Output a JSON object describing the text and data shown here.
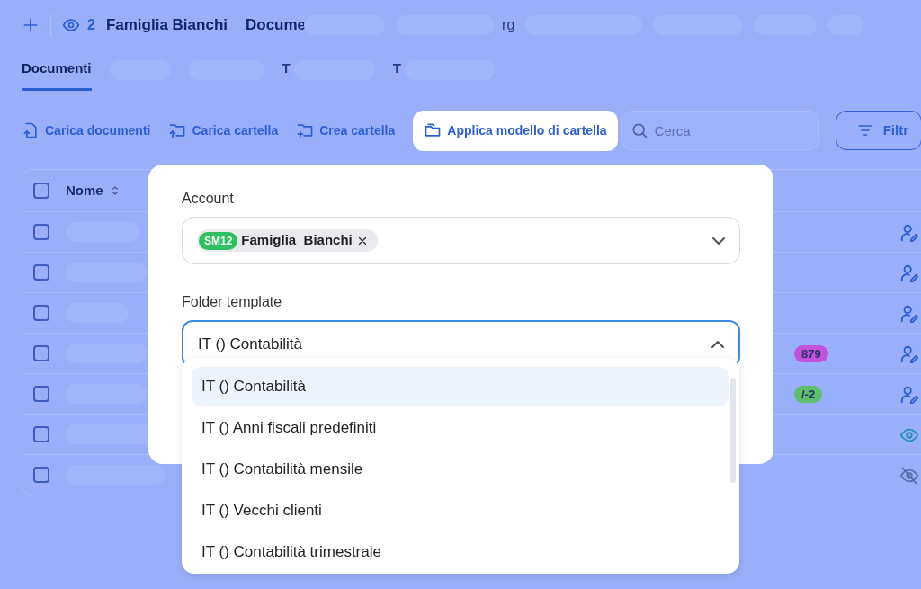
{
  "header": {
    "viewer_count": "2",
    "account": "Famiglia Bianchi",
    "breadcrumb": "Docume",
    "fragment": "rg"
  },
  "tabs": [
    {
      "label": "Documenti",
      "selected": true
    },
    {
      "label": "T",
      "selected": false
    },
    {
      "label": "T",
      "selected": false
    }
  ],
  "toolbar": {
    "actions": [
      {
        "kind": "upload-file",
        "label": "Carica documenti",
        "highlighted": false
      },
      {
        "kind": "upload-folder",
        "label": "Carica cartella",
        "highlighted": false
      },
      {
        "kind": "create-folder",
        "label": "Crea cartella",
        "highlighted": false
      },
      {
        "kind": "template",
        "label": "Applica modello di  cartella",
        "highlighted": true
      }
    ],
    "search": {
      "placeholder": "Cerca"
    },
    "filter": "Filtr"
  },
  "table": {
    "column": "Nome",
    "header_checked": false,
    "rows": [
      {
        "kind": "edit-user",
        "checked": false
      },
      {
        "kind": "edit-user",
        "checked": false
      },
      {
        "kind": "edit-user",
        "checked": false
      },
      {
        "kind": "edit-user",
        "checked": false,
        "tag": {
          "text": "879",
          "color": "#c152dc"
        }
      },
      {
        "kind": "edit-user",
        "checked": false,
        "tag": {
          "text": "/-2",
          "color": "#5dbf6c"
        }
      },
      {
        "kind": "view",
        "checked": false
      },
      {
        "kind": "hidden",
        "checked": false
      }
    ]
  },
  "modal": {
    "account_label": "Account",
    "account_chip": {
      "code": "SM12",
      "name": "Famiglia  Bianchi"
    },
    "template_label": "Folder template",
    "template_value": "IT () Contabilità",
    "expanded": true,
    "options": [
      {
        "label": "IT () Contabilità",
        "selected": true
      },
      {
        "label": "IT () Anni fiscali predefiniti",
        "selected": false
      },
      {
        "label": "IT () Contabilità mensile",
        "selected": false
      },
      {
        "label": "IT () Vecchi clienti",
        "selected": false
      },
      {
        "label": "IT () Contabilità trimestrale",
        "selected": false
      }
    ]
  }
}
